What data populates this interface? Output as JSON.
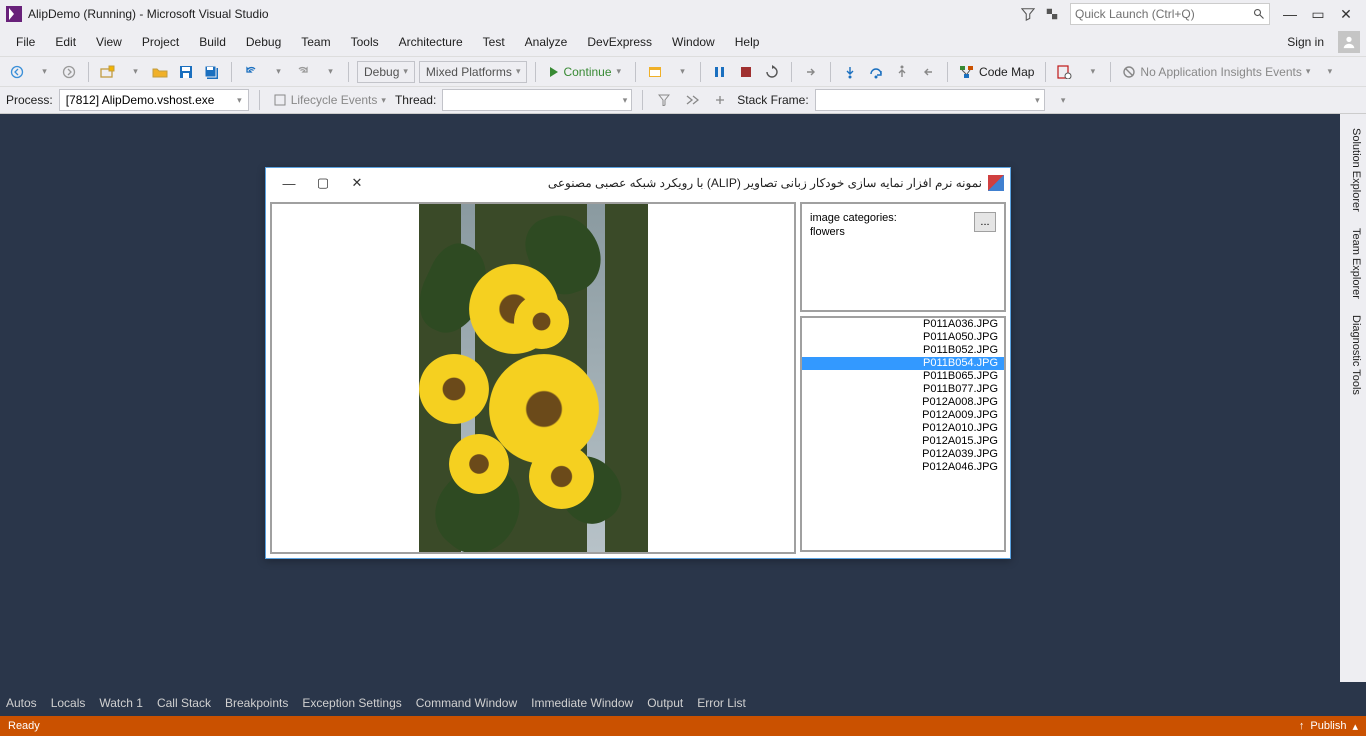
{
  "titlebar": {
    "title": "AlipDemo (Running) - Microsoft Visual Studio",
    "quick_launch_placeholder": "Quick Launch (Ctrl+Q)"
  },
  "menubar": {
    "items": [
      "File",
      "Edit",
      "View",
      "Project",
      "Build",
      "Debug",
      "Team",
      "Tools",
      "Architecture",
      "Test",
      "Analyze",
      "DevExpress",
      "Window",
      "Help"
    ],
    "signin": "Sign in"
  },
  "toolbar1": {
    "config": "Debug",
    "platform": "Mixed Platforms",
    "continue": "Continue",
    "codemap": "Code Map",
    "insights": "No Application Insights Events"
  },
  "toolbar2": {
    "process_label": "Process:",
    "process_value": "[7812] AlipDemo.vshost.exe",
    "lifecycle": "Lifecycle Events",
    "thread_label": "Thread:",
    "stackframe_label": "Stack Frame:"
  },
  "right_tabs": [
    "Solution Explorer",
    "Team Explorer",
    "Diagnostic Tools"
  ],
  "debug_tabs": [
    "Autos",
    "Locals",
    "Watch 1",
    "Call Stack",
    "Breakpoints",
    "Exception Settings",
    "Command Window",
    "Immediate Window",
    "Output",
    "Error List"
  ],
  "statusbar": {
    "ready": "Ready",
    "publish": "Publish"
  },
  "app": {
    "title": "نمونه نرم افزار نمایه سازی خودکار زبانی تصاویر (ALIP) با رویکرد شبکه عصبی مصنوعی",
    "categories_label": ":image categories",
    "categories_value": "flowers",
    "dots": "...",
    "files": [
      "P011A036.JPG",
      "P011A050.JPG",
      "P011B052.JPG",
      "P011B054.JPG",
      "P011B065.JPG",
      "P011B077.JPG",
      "P012A008.JPG",
      "P012A009.JPG",
      "P012A010.JPG",
      "P012A015.JPG",
      "P012A039.JPG",
      "P012A046.JPG"
    ],
    "selected_index": 3
  }
}
